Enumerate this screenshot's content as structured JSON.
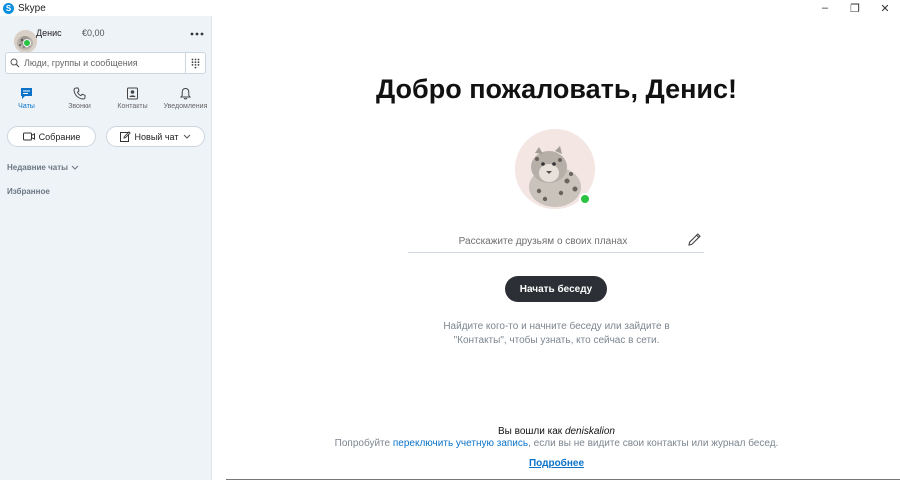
{
  "window": {
    "title": "Skype",
    "logo_letter": "S",
    "controls": [
      "–",
      "❐",
      "✕"
    ]
  },
  "profile": {
    "name": "Денис",
    "balance": "€0,00",
    "status_color": "#29c341"
  },
  "search": {
    "placeholder": "Люди, группы и сообщения"
  },
  "nav": {
    "tabs": [
      {
        "label": "Чаты",
        "icon": "chat-icon",
        "active": true
      },
      {
        "label": "Звонки",
        "icon": "phone-icon",
        "active": false
      },
      {
        "label": "Контакты",
        "icon": "contacts-icon",
        "active": false
      },
      {
        "label": "Уведомления",
        "icon": "bell-icon",
        "active": false
      }
    ]
  },
  "actions": {
    "meeting_label": "Собрание",
    "new_chat_label": "Новый чат"
  },
  "sections": {
    "recent_label": "Недавние чаты",
    "favorites_label": "Избранное"
  },
  "main": {
    "welcome": "Добро пожаловать, Денис!",
    "mood_placeholder": "Расскажите друзьям о своих планах",
    "start_button": "Начать беседу",
    "hint_line1": "Найдите кого-то и начните беседу или зайдите в",
    "hint_line2": "\"Контакты\", чтобы узнать, кто сейчас в сети.",
    "signed_in_prefix": "Вы вошли как",
    "username": "deniskalion",
    "switch_prefix": "Попробуйте",
    "switch_link": "переключить учетную запись",
    "switch_suffix": ", если вы не видите свои контакты или журнал бесед.",
    "more_link": "Подробнее"
  },
  "colors": {
    "accent": "#0a73c9",
    "sidebar_bg": "#eef3f8",
    "dark_button": "#2c2f36"
  }
}
